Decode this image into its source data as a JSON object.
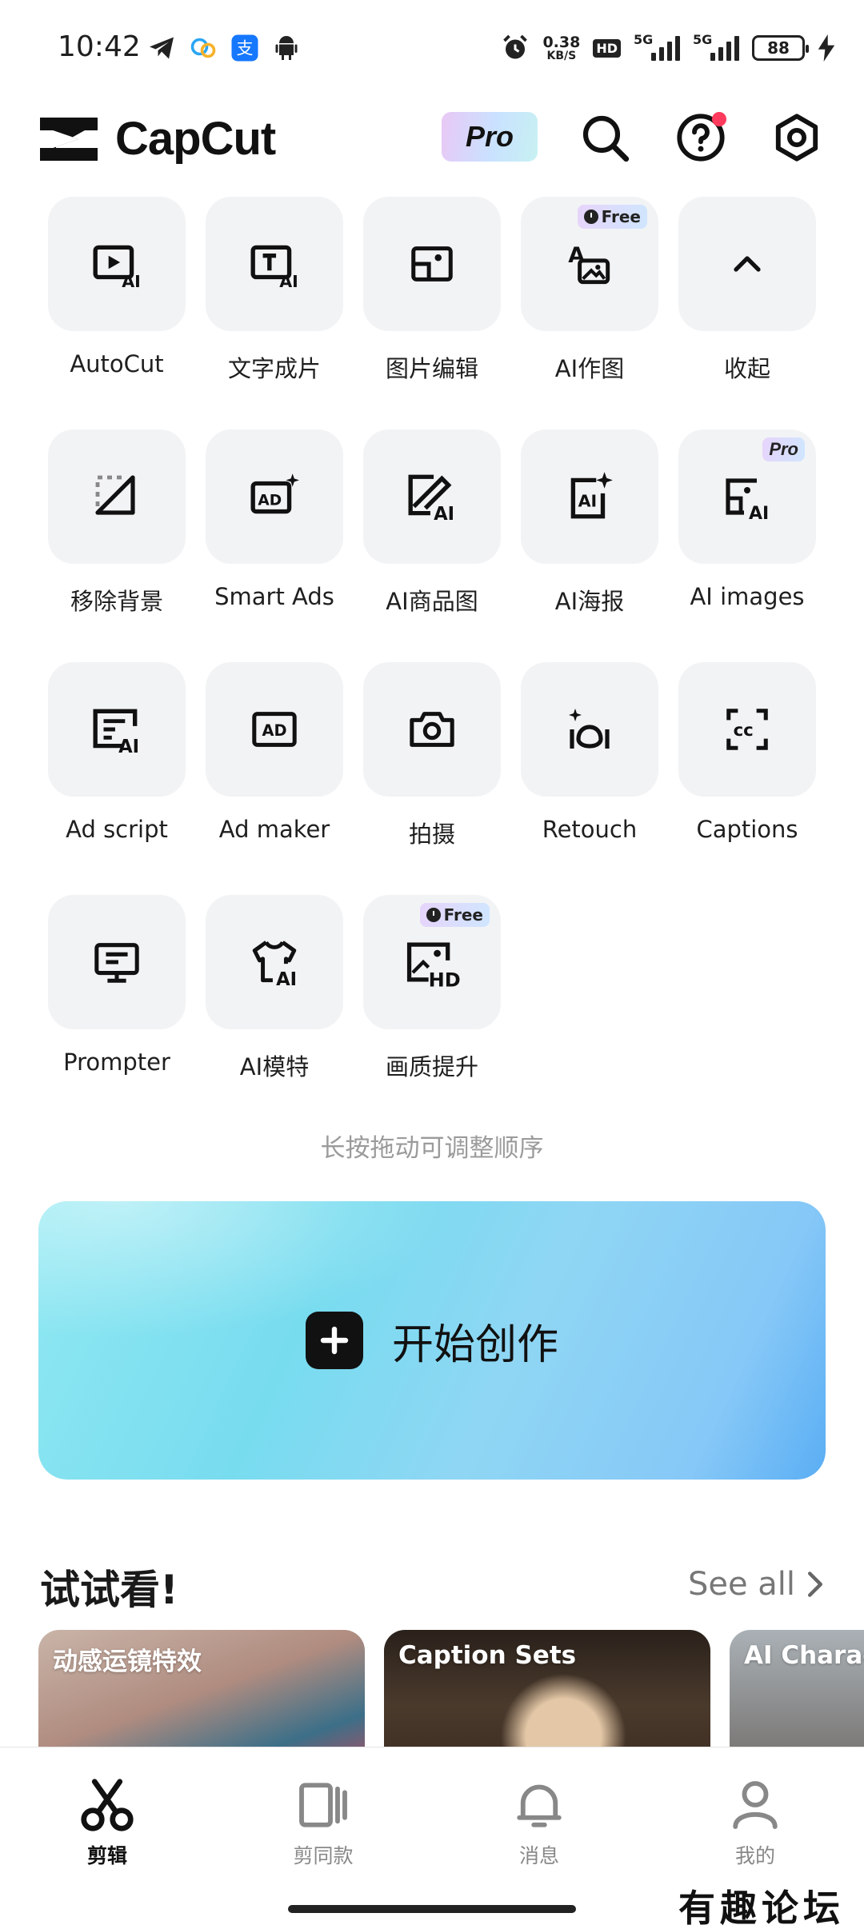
{
  "status_bar": {
    "time": "10:42",
    "net_speed_value": "0.38",
    "net_speed_unit": "KB/S",
    "hd_label": "HD",
    "signal_1_label": "5G",
    "signal_2_label": "5G",
    "battery": "88",
    "icons": [
      "telegram-icon",
      "chat-bubble-icon",
      "alipay-icon",
      "android-icon",
      "alarm-icon",
      "charging-icon"
    ]
  },
  "header": {
    "app_name": "CapCut",
    "pro_label": "Pro",
    "icons": [
      "search-icon",
      "help-icon",
      "settings-icon"
    ],
    "notification_dot_color": "#ff3a5c"
  },
  "tools": [
    {
      "label": "AutoCut",
      "icon": "autocut-icon",
      "tag": ""
    },
    {
      "label": "文字成片",
      "icon": "text-to-video-icon",
      "tag": ""
    },
    {
      "label": "图片编辑",
      "icon": "photo-edit-icon",
      "tag": ""
    },
    {
      "label": "AI作图",
      "icon": "ai-draw-icon",
      "tag": "Free"
    },
    {
      "label": "收起",
      "icon": "chevron-up-icon",
      "tag": ""
    },
    {
      "label": "移除背景",
      "icon": "remove-background-icon",
      "tag": ""
    },
    {
      "label": "Smart Ads",
      "icon": "smart-ads-icon",
      "tag": ""
    },
    {
      "label": "AI商品图",
      "icon": "ai-product-image-icon",
      "tag": ""
    },
    {
      "label": "AI海报",
      "icon": "ai-poster-icon",
      "tag": ""
    },
    {
      "label": "AI images",
      "icon": "ai-images-icon",
      "tag": "Pro"
    },
    {
      "label": "Ad script",
      "icon": "ad-script-icon",
      "tag": ""
    },
    {
      "label": "Ad maker",
      "icon": "ad-maker-icon",
      "tag": ""
    },
    {
      "label": "拍摄",
      "icon": "camera-icon",
      "tag": ""
    },
    {
      "label": "Retouch",
      "icon": "retouch-icon",
      "tag": ""
    },
    {
      "label": "Captions",
      "icon": "captions-icon",
      "tag": ""
    },
    {
      "label": "Prompter",
      "icon": "prompter-icon",
      "tag": ""
    },
    {
      "label": "AI模特",
      "icon": "ai-model-icon",
      "tag": ""
    },
    {
      "label": "画质提升",
      "icon": "enhance-quality-icon",
      "tag": "Free"
    }
  ],
  "hint": "长按拖动可调整顺序",
  "start_create": {
    "label": "开始创作",
    "icon": "plus-icon"
  },
  "try_section": {
    "title": "试试看!",
    "see_all": "See all",
    "cards": [
      {
        "title": "动感运镜特效"
      },
      {
        "title": "Caption Sets"
      },
      {
        "title": "AI Charact"
      }
    ]
  },
  "bottom_nav": [
    {
      "label": "剪辑",
      "icon": "scissors-icon",
      "active": true
    },
    {
      "label": "剪同款",
      "icon": "template-icon",
      "active": false
    },
    {
      "label": "消息",
      "icon": "bell-icon",
      "active": false
    },
    {
      "label": "我的",
      "icon": "profile-icon",
      "active": false
    }
  ],
  "watermark": "有趣论坛"
}
